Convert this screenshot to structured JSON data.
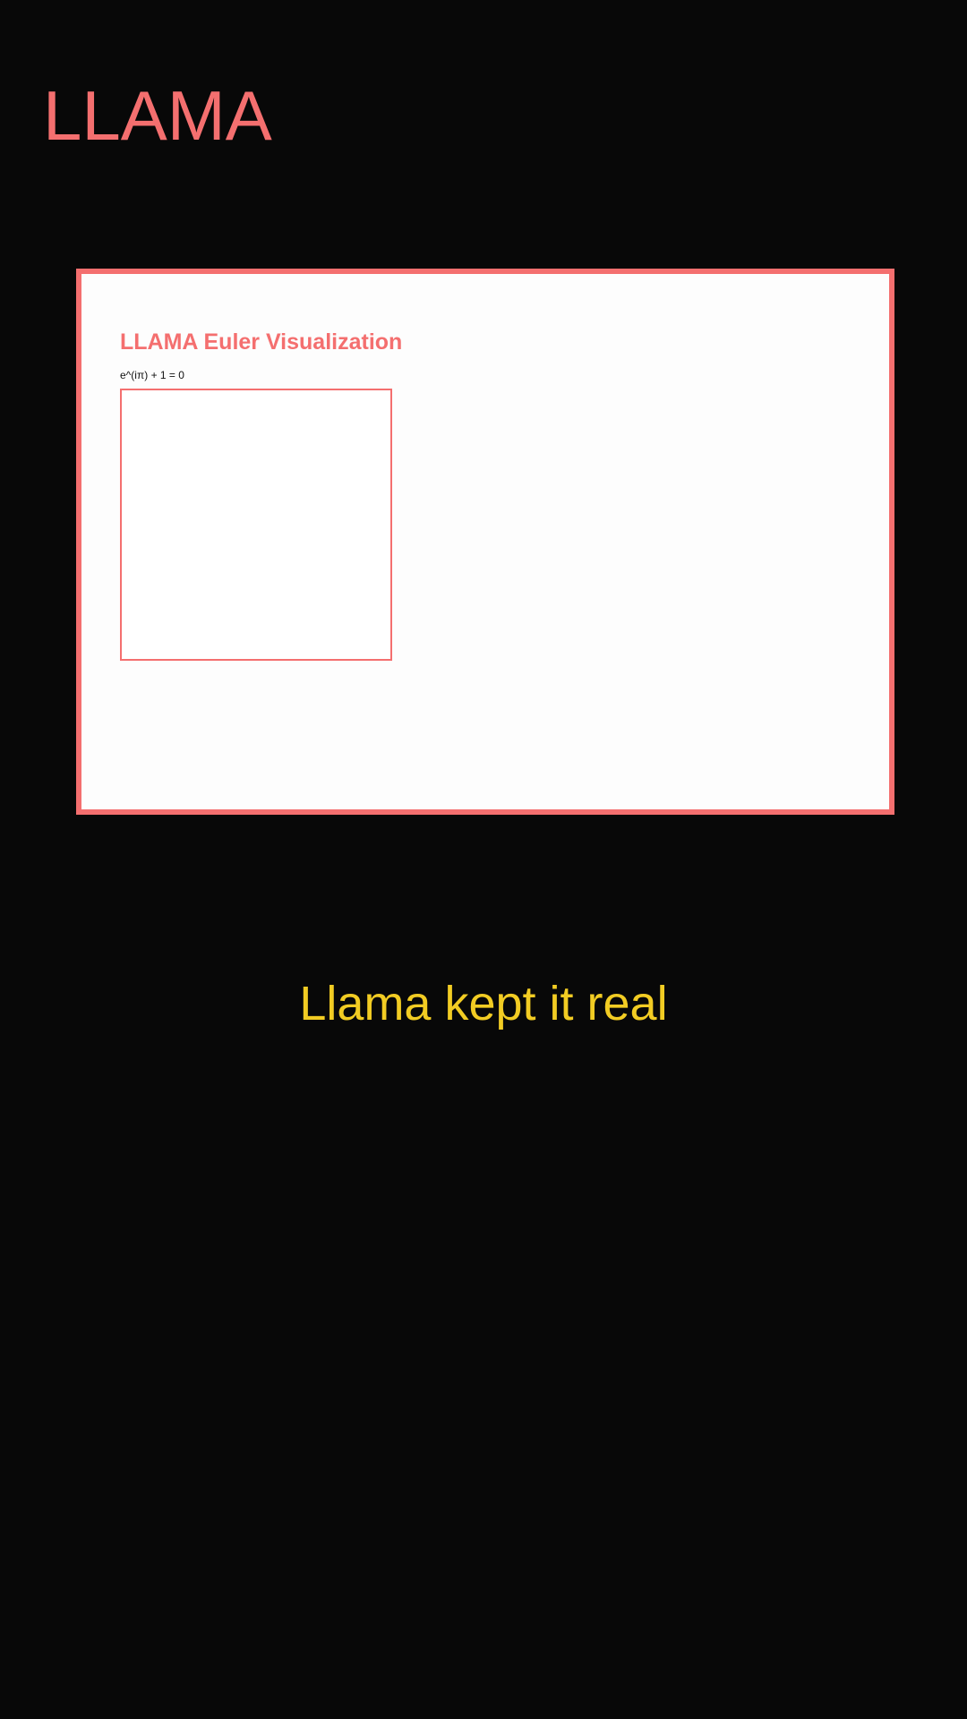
{
  "header": {
    "brand": "LLAMA"
  },
  "panel": {
    "title": "LLAMA Euler Visualization",
    "formula": "e^(iπ) + 1 = 0"
  },
  "footer": {
    "caption": "Llama kept it real"
  },
  "colors": {
    "background": "#080808",
    "accent": "#f46f6f",
    "panel": "#fdfdfd",
    "caption": "#f2cc23"
  }
}
